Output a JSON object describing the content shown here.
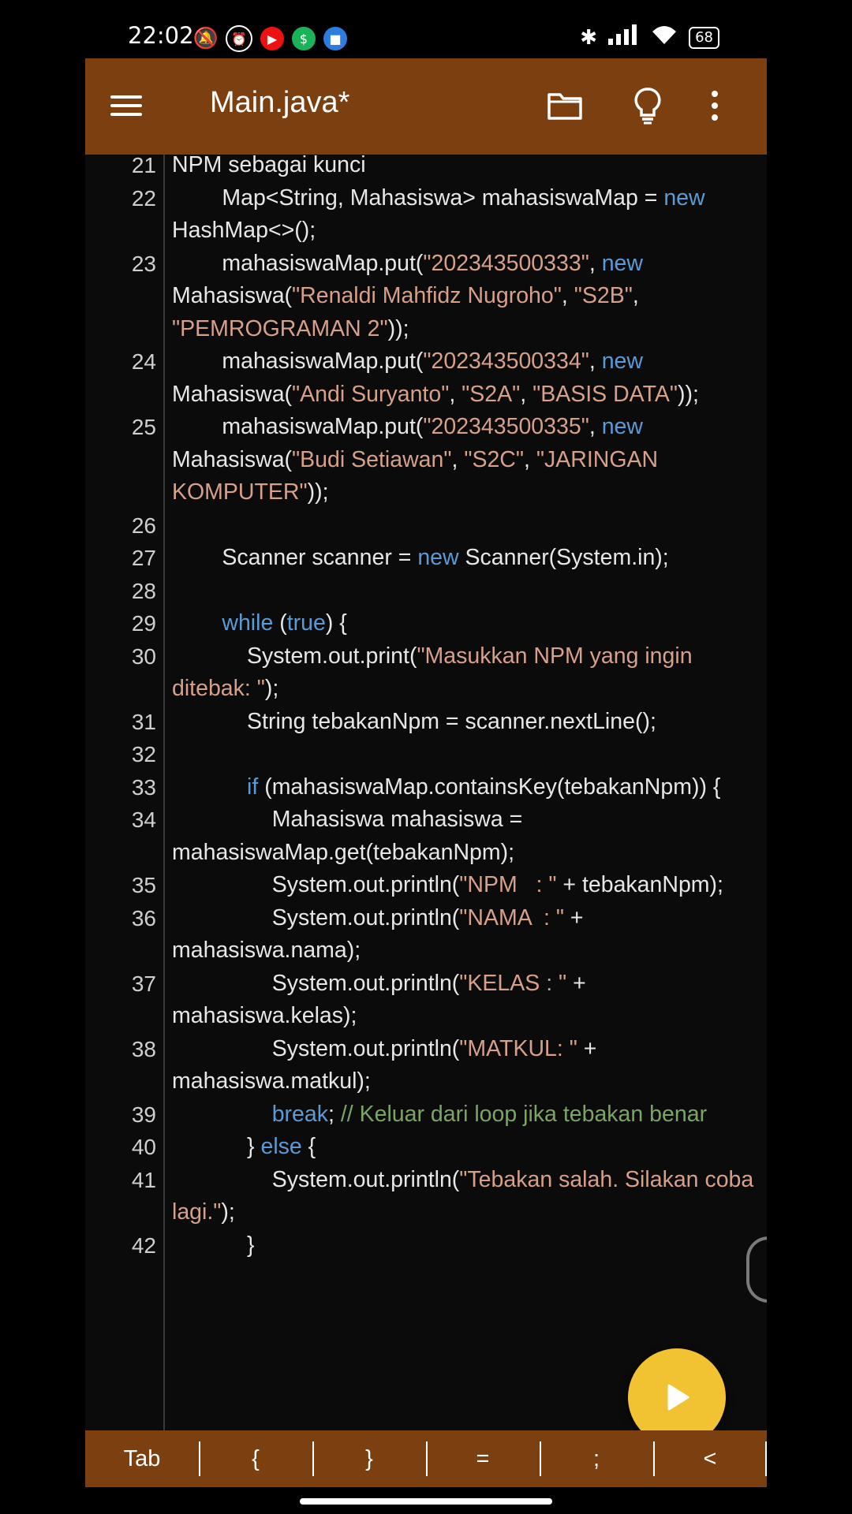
{
  "status_bar": {
    "time": "22:02",
    "battery": "68",
    "icons_left": [
      "do-not-disturb-icon",
      "alarm-icon",
      "youtube-icon",
      "app-green-icon",
      "app-blue-icon"
    ],
    "icons_right": [
      "bluetooth-icon",
      "signal-icon",
      "wifi-icon",
      "battery-icon"
    ]
  },
  "toolbar": {
    "title": "Main.java*",
    "icons": [
      "menu-icon",
      "folder-icon",
      "lightbulb-icon",
      "more-vert-icon"
    ],
    "background": "#7c3f10"
  },
  "editor": {
    "lines": [
      {
        "n": "21",
        "html": "NPM sebagai kunci"
      },
      {
        "n": "22",
        "html": "        Map&lt;String, Mahasiswa&gt; mahasiswaMap = <span class=\"kw\">new</span> HashMap&lt;&gt;();"
      },
      {
        "n": "23",
        "html": "        mahasiswaMap.put(<span class=\"str\">\"202343500333\"</span>, <span class=\"kw\">new</span> Mahasiswa(<span class=\"str\">\"Renaldi Mahfidz Nugroho\"</span>, <span class=\"str\">\"S2B\"</span>, <span class=\"str\">\"PEMROGRAMAN 2\"</span>));"
      },
      {
        "n": "24",
        "html": "        mahasiswaMap.put(<span class=\"str\">\"202343500334\"</span>, <span class=\"kw\">new</span> Mahasiswa(<span class=\"str\">\"Andi Suryanto\"</span>, <span class=\"str\">\"S2A\"</span>, <span class=\"str\">\"BASIS DATA\"</span>));"
      },
      {
        "n": "25",
        "html": "        mahasiswaMap.put(<span class=\"str\">\"202343500335\"</span>, <span class=\"kw\">new</span> Mahasiswa(<span class=\"str\">\"Budi Setiawan\"</span>, <span class=\"str\">\"S2C\"</span>, <span class=\"str\">\"JARINGAN KOMPUTER\"</span>));"
      },
      {
        "n": "26",
        "html": " "
      },
      {
        "n": "27",
        "html": "        Scanner scanner = <span class=\"kw\">new</span> Scanner(System.in);"
      },
      {
        "n": "28",
        "html": " "
      },
      {
        "n": "29",
        "html": "        <span class=\"kw\">while</span> (<span class=\"kw\">true</span>) {"
      },
      {
        "n": "30",
        "html": "            System.out.print(<span class=\"str\">\"Masukkan NPM yang ingin ditebak: \"</span>);"
      },
      {
        "n": "31",
        "html": "            String tebakanNpm = scanner.nextLine();\n"
      },
      {
        "n": "32",
        "html": " "
      },
      {
        "n": "33",
        "html": "            <span class=\"kw\">if</span> (mahasiswaMap.containsKey(tebakanNpm)) {"
      },
      {
        "n": "34",
        "html": "                Mahasiswa mahasiswa = mahasiswaMap.get(tebakanNpm);"
      },
      {
        "n": "35",
        "html": "                System.out.println(<span class=\"str\">\"NPM   : \"</span> + tebakanNpm);"
      },
      {
        "n": "36",
        "html": "                System.out.println(<span class=\"str\">\"NAMA  : \"</span> + mahasiswa.nama);"
      },
      {
        "n": "37",
        "html": "                System.out.println(<span class=\"str\">\"KELAS : \"</span> + mahasiswa.kelas);"
      },
      {
        "n": "38",
        "html": "                System.out.println(<span class=\"str\">\"MATKUL: \"</span> + mahasiswa.matkul);"
      },
      {
        "n": "39",
        "html": "                <span class=\"kw\">break</span>; <span class=\"cm\">// Keluar dari loop jika tebakan benar</span>"
      },
      {
        "n": "40",
        "html": "            } <span class=\"kw\">else</span> {"
      },
      {
        "n": "41",
        "html": "                System.out.println(<span class=\"str\">\"Tebakan salah. Silakan coba lagi.\"</span>);"
      },
      {
        "n": "42",
        "html": "            }"
      }
    ]
  },
  "keybar": {
    "keys": [
      "Tab",
      "{",
      "}",
      "=",
      ";",
      "<"
    ]
  }
}
